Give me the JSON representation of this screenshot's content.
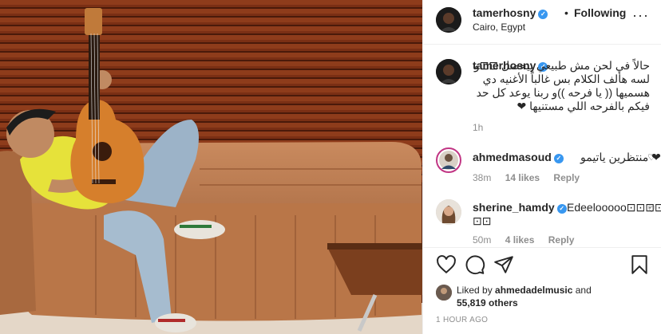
{
  "post": {
    "username": "tamerhosny",
    "separator": "•",
    "follow_status": "Following",
    "location": "Cairo, Egypt",
    "more_glyph": "···"
  },
  "caption": {
    "username": "tamerhosny",
    "text": "حالاً في لحن مش طبيعي بيحصل ⊡⊡و لسه هألف الكلام بس غالباً الأغنيه دي هسميها (( يا فرحه ))و ربنا يوعد كل حد فيكم بالفرحه اللي مستنيها ❤",
    "time": "1h"
  },
  "comments": [
    {
      "username": "ahmedmasoud",
      "text": "منتظرين ياتيمو ❤",
      "time": "38m",
      "likes": "14 likes",
      "reply": "Reply"
    },
    {
      "username": "sherine_hamdy",
      "text": "Edeelooooo⊡⊡⊡⊡",
      "text2": "⊡⊡",
      "time": "50m",
      "likes": "4 likes",
      "reply": "Reply"
    }
  ],
  "likes": {
    "prefix": "Liked by ",
    "user": "ahmedadelmusic",
    "suffix": " and",
    "count": "55,819 others"
  },
  "timestamp": "1 HOUR AGO",
  "icons": [
    "heart-icon",
    "comment-icon",
    "share-icon",
    "bookmark-icon",
    "verified-icon",
    "more-icon"
  ],
  "colors": {
    "verified": "#3897f0",
    "muted": "#8e8e8e",
    "text": "#262626"
  }
}
